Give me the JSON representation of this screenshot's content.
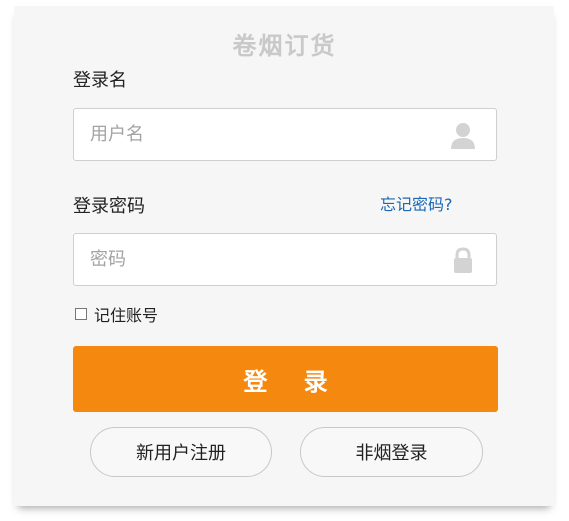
{
  "header": {
    "title": "卷烟订货"
  },
  "login_form": {
    "username_label": "登录名",
    "username_placeholder": "用户名",
    "password_label": "登录密码",
    "password_placeholder": "密码",
    "forgot_password": "忘记密码?",
    "remember_account": "记住账号",
    "login_button": "登 录"
  },
  "footer_buttons": {
    "register": "新用户注册",
    "non_cigarette_login": "非烟登录"
  },
  "icons": {
    "user": "user-icon",
    "lock": "lock-icon"
  },
  "colors": {
    "accent": "#f5890f",
    "link": "#1a67b6"
  }
}
